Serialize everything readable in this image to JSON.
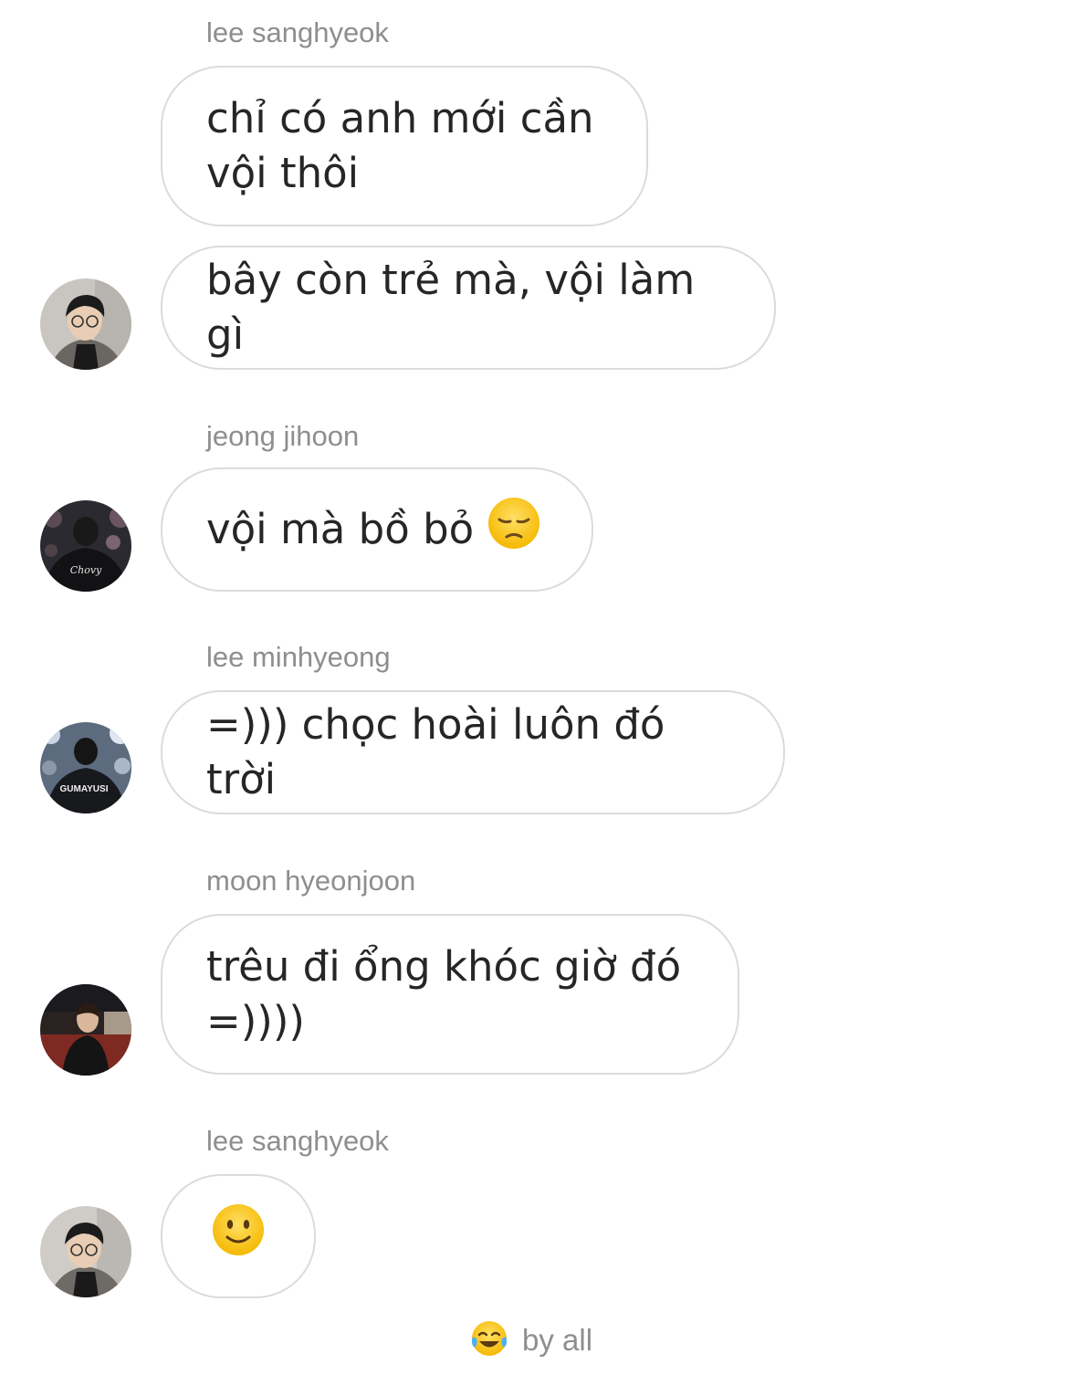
{
  "thread": {
    "messages": [
      {
        "sender": "lee sanghyeok",
        "lines": [
          "chỉ có anh mới cần",
          "vội thôi"
        ]
      },
      {
        "lines": [
          "bây còn trẻ mà, vội làm gì"
        ]
      },
      {
        "sender": "jeong jihoon",
        "text": "vội mà bồ bỏ",
        "emoji": "pensive-face-emoji"
      },
      {
        "sender": "lee minhyeong",
        "text": "=))) chọc hoài luôn đó trời"
      },
      {
        "sender": "moon hyeonjoon",
        "lines": [
          "trêu đi ổng khóc giờ đó",
          "=))))"
        ]
      },
      {
        "sender": "lee sanghyeok",
        "emoji": "slightly-smiling-face-emoji"
      }
    ],
    "jersey_texts": [
      "Chovy",
      "GUMAYUSI"
    ],
    "reaction": {
      "emoji": "face-with-tears-of-joy-emoji",
      "label": "by all"
    }
  }
}
